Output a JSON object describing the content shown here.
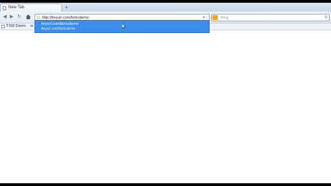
{
  "tabs": [
    {
      "label": "New Tab"
    }
  ],
  "newtab_symbol": "+",
  "nav": {
    "back": "◀",
    "forward": "▶",
    "reload": "↻",
    "stop": "✕"
  },
  "address_bar": {
    "value": "http://tinyurl.com/brmcdemo"
  },
  "search_bar": {
    "placeholder": "Bing"
  },
  "bookmarks": [
    "TSW Demo",
    "w"
  ],
  "autocomplete": {
    "title": "tinyurl.com/brmcdemo",
    "url": "tinyurl.com/brmcdemo"
  }
}
